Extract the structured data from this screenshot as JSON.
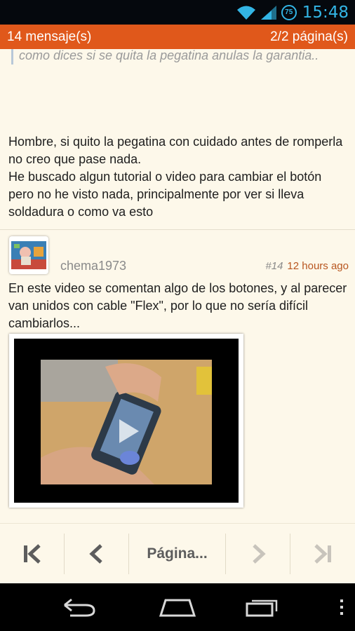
{
  "status_bar": {
    "battery_level": "75",
    "time": "15:48",
    "accent_color": "#33b5e5"
  },
  "header": {
    "message_count": "14 mensaje(s)",
    "page_indicator": "2/2 página(s)",
    "color": "#e0581b"
  },
  "quote": {
    "text": "como dices si se quita la pegatina anulas la garantia.."
  },
  "reply_post": {
    "lines": [
      "Hombre, si quito la pegatina con cuidado antes de romperla no creo que pase nada.",
      "He buscado algun tutorial o video para cambiar el botón pero no he visto nada, principalmente por ver si lleva soldadura o como va esto"
    ]
  },
  "post": {
    "username": "chema1973",
    "number": "#14",
    "time": "12 hours ago",
    "text": "En este video se comentan algo de los botones, y al parecer van unidos con cable \"Flex\", por lo que no sería difícil cambiarlos..."
  },
  "pager": {
    "label": "Página...",
    "icons": [
      "first-page-icon",
      "previous-page-icon",
      "next-page-icon",
      "last-page-icon"
    ]
  },
  "nav_bar": {
    "icons": [
      "back-icon",
      "home-icon",
      "recent-apps-icon",
      "overflow-menu-icon"
    ]
  }
}
